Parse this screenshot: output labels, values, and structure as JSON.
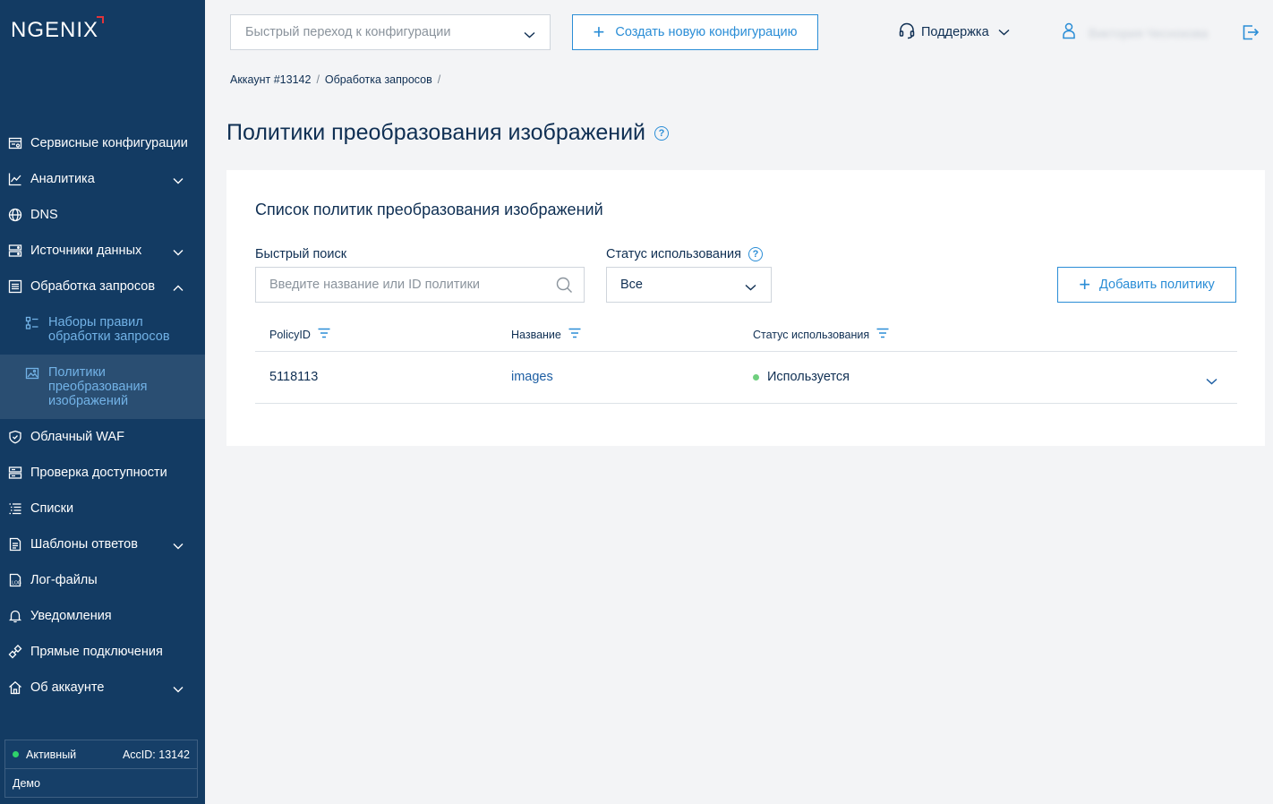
{
  "brand": {
    "logo_text": "NGENIX"
  },
  "sidebar": {
    "items": [
      {
        "label": "Сервисные конфигурации",
        "icon": "config-icon"
      },
      {
        "label": "Аналитика",
        "icon": "chart-icon",
        "expandable": true
      },
      {
        "label": "DNS",
        "icon": "globe-icon"
      },
      {
        "label": "Источники данных",
        "icon": "server-icon",
        "expandable": true
      },
      {
        "label": "Обработка запросов",
        "icon": "list-icon",
        "expandable": true,
        "expanded": true
      },
      {
        "label": "Облачный WAF",
        "icon": "shield-icon"
      },
      {
        "label": "Проверка доступности",
        "icon": "check-icon"
      },
      {
        "label": "Списки",
        "icon": "lists-icon"
      },
      {
        "label": "Шаблоны ответов",
        "icon": "template-icon",
        "expandable": true
      },
      {
        "label": "Лог-файлы",
        "icon": "log-icon"
      },
      {
        "label": "Уведомления",
        "icon": "bell-icon"
      },
      {
        "label": "Прямые подключения",
        "icon": "link-icon"
      },
      {
        "label": "Об аккаунте",
        "icon": "home-icon",
        "expandable": true
      }
    ],
    "sub_items": [
      {
        "label": "Наборы правил обработки запросов",
        "icon": "rules-icon"
      },
      {
        "label": "Политики преобразования изображений",
        "icon": "image-icon",
        "active": true
      }
    ],
    "status": {
      "state": "Активный",
      "acc_id": "AccID: 13142",
      "plan": "Демо"
    }
  },
  "topbar": {
    "quick_placeholder": "Быстрый переход к конфигурации",
    "create_label": "Создать новую конфигурацию",
    "support_label": "Поддержка",
    "user_name": "Виктория Чеснокова"
  },
  "breadcrumb": [
    "Аккаунт #13142",
    "Обработка запросов"
  ],
  "page": {
    "title": "Политики преобразования изображений"
  },
  "card": {
    "title": "Список политик преобразования изображений",
    "search_label": "Быстрый поиск",
    "search_placeholder": "Введите название или ID политики",
    "status_label": "Статус использования",
    "status_value": "Все",
    "add_label": "Добавить политику",
    "columns": [
      "PolicyID",
      "Название",
      "Статус использования"
    ],
    "rows": [
      {
        "id": "5118113",
        "name": "images",
        "status": "Используется"
      }
    ]
  },
  "colors": {
    "sidebar": "#133b63",
    "accent": "#2a8dd6",
    "active": "#2a4e72",
    "status_ok": "#6fcf7e"
  }
}
